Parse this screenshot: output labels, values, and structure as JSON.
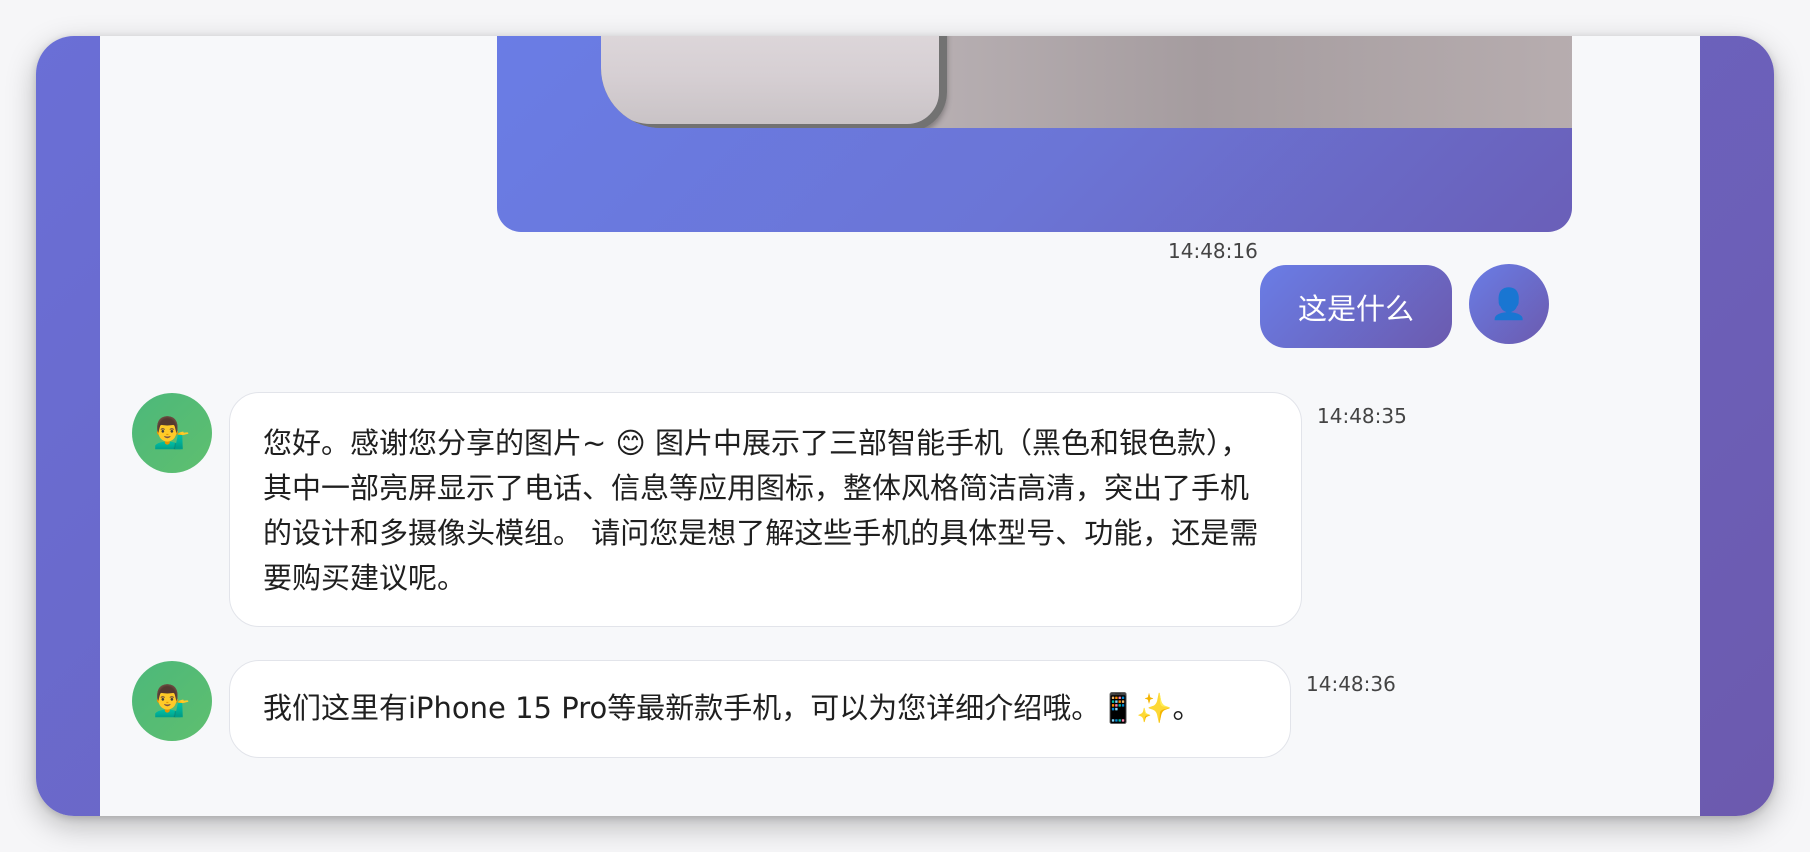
{
  "messages": [
    {
      "role": "user",
      "type": "image",
      "avatar_icon": "user-icon"
    },
    {
      "role": "user",
      "type": "text",
      "text": "这是什么",
      "time": "14:48:16",
      "avatar_glyph": "👤",
      "avatar_icon": "user-icon"
    },
    {
      "role": "bot",
      "type": "text",
      "text": "您好。感谢您分享的图片~ 😊 图片中展示了三部智能手机（黑色和银色款），其中一部亮屏显示了电话、信息等应用图标，整体风格简洁高清，突出了手机的设计和多摄像头模组。 请问您是想了解这些手机的具体型号、功能，还是需要购买建议呢。",
      "time": "14:48:35",
      "avatar_glyph": "💁‍♂️",
      "avatar_icon": "assistant-icon"
    },
    {
      "role": "bot",
      "type": "text",
      "text": "我们这里有iPhone 15 Pro等最新款手机，可以为您详细介绍哦。📱✨。",
      "time": "14:48:36",
      "avatar_glyph": "💁‍♂️",
      "avatar_icon": "assistant-icon"
    }
  ],
  "colors": {
    "accent_start": "#6a7de6",
    "accent_end": "#6b5aae",
    "bot_avatar": "#4cb87a",
    "chat_background": "#f7f8fa"
  }
}
